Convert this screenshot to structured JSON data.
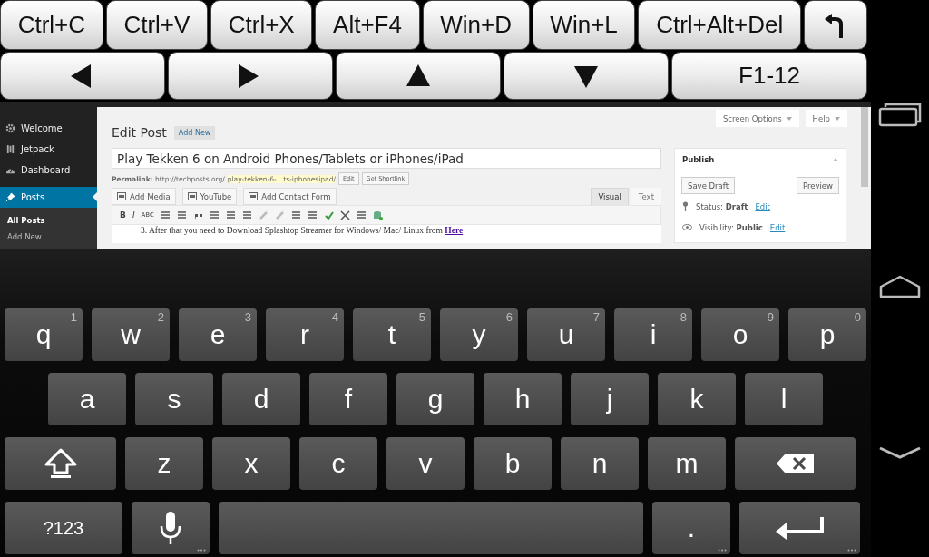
{
  "shortcut_rows": [
    [
      {
        "kind": "text",
        "label": "Ctrl+C"
      },
      {
        "kind": "text",
        "label": "Ctrl+V"
      },
      {
        "kind": "text",
        "label": "Ctrl+X"
      },
      {
        "kind": "text",
        "label": "Alt+F4"
      },
      {
        "kind": "text",
        "label": "Win+D"
      },
      {
        "kind": "text",
        "label": "Win+L"
      },
      {
        "kind": "text",
        "label": "Ctrl+Alt+Del"
      },
      {
        "kind": "back"
      }
    ],
    [
      {
        "kind": "left"
      },
      {
        "kind": "right"
      },
      {
        "kind": "up"
      },
      {
        "kind": "down"
      },
      {
        "kind": "text",
        "label": "F1-12"
      }
    ]
  ],
  "remote_screen": {
    "sidebar": {
      "items": [
        {
          "label": "Welcome",
          "selected": false
        },
        {
          "label": "Jetpack",
          "selected": false
        },
        {
          "label": "Dashboard",
          "selected": false
        },
        {
          "label": "Posts",
          "selected": true
        }
      ],
      "submenu": [
        {
          "label": "All Posts",
          "selected": true
        },
        {
          "label": "Add New",
          "selected": false
        }
      ]
    },
    "screen_options": "Screen Options",
    "help": "Help",
    "page_title": "Edit Post",
    "add_new": "Add New",
    "post_title": "Play Tekken 6 on Android Phones/Tablets or iPhones/iPad",
    "permalink": {
      "label": "Permalink:",
      "base": "http://techposts.org/",
      "slug": "play-tekken-6-…ts-iphonesipad/",
      "buttons": [
        "Edit",
        "Get Shortlink"
      ]
    },
    "media_buttons": [
      "Add Media",
      "YouTube",
      "Add Contact Form"
    ],
    "editor_tabs": [
      {
        "label": "Visual",
        "selected": true
      },
      {
        "label": "Text",
        "selected": false
      }
    ],
    "toolbar_letters": [
      "B",
      "I",
      "ABC"
    ],
    "content_line": {
      "number": "3.",
      "text": "After that you need to Download Splashtop Streamer for Windows/ Mac/ Linux from",
      "link": "Here"
    },
    "publish": {
      "title": "Publish",
      "buttons": [
        "Save Draft",
        "Preview"
      ],
      "rows": [
        {
          "label": "Status:",
          "value": "Draft",
          "link": "Edit"
        },
        {
          "label": "Visibility:",
          "value": "Public",
          "link": "Edit"
        }
      ]
    }
  },
  "keyboard": {
    "rows": [
      [
        {
          "kind": "char",
          "label": "q",
          "hint": "1"
        },
        {
          "kind": "char",
          "label": "w",
          "hint": "2"
        },
        {
          "kind": "char",
          "label": "e",
          "hint": "3"
        },
        {
          "kind": "char",
          "label": "r",
          "hint": "4"
        },
        {
          "kind": "char",
          "label": "t",
          "hint": "5"
        },
        {
          "kind": "char",
          "label": "y",
          "hint": "6"
        },
        {
          "kind": "char",
          "label": "u",
          "hint": "7"
        },
        {
          "kind": "char",
          "label": "i",
          "hint": "8"
        },
        {
          "kind": "char",
          "label": "o",
          "hint": "9"
        },
        {
          "kind": "char",
          "label": "p",
          "hint": "0"
        }
      ],
      [
        {
          "kind": "char",
          "label": "a"
        },
        {
          "kind": "char",
          "label": "s"
        },
        {
          "kind": "char",
          "label": "d"
        },
        {
          "kind": "char",
          "label": "f"
        },
        {
          "kind": "char",
          "label": "g"
        },
        {
          "kind": "char",
          "label": "h"
        },
        {
          "kind": "char",
          "label": "j"
        },
        {
          "kind": "char",
          "label": "k"
        },
        {
          "kind": "char",
          "label": "l"
        }
      ],
      [
        {
          "kind": "shift"
        },
        {
          "kind": "char",
          "label": "z"
        },
        {
          "kind": "char",
          "label": "x"
        },
        {
          "kind": "char",
          "label": "c"
        },
        {
          "kind": "char",
          "label": "v"
        },
        {
          "kind": "char",
          "label": "b"
        },
        {
          "kind": "char",
          "label": "n"
        },
        {
          "kind": "char",
          "label": "m"
        },
        {
          "kind": "backspace"
        }
      ],
      [
        {
          "kind": "symbols",
          "label": "?123"
        },
        {
          "kind": "mic",
          "more": true
        },
        {
          "kind": "space"
        },
        {
          "kind": "char",
          "label": ".",
          "more": true
        },
        {
          "kind": "enter",
          "more": true
        }
      ]
    ]
  }
}
